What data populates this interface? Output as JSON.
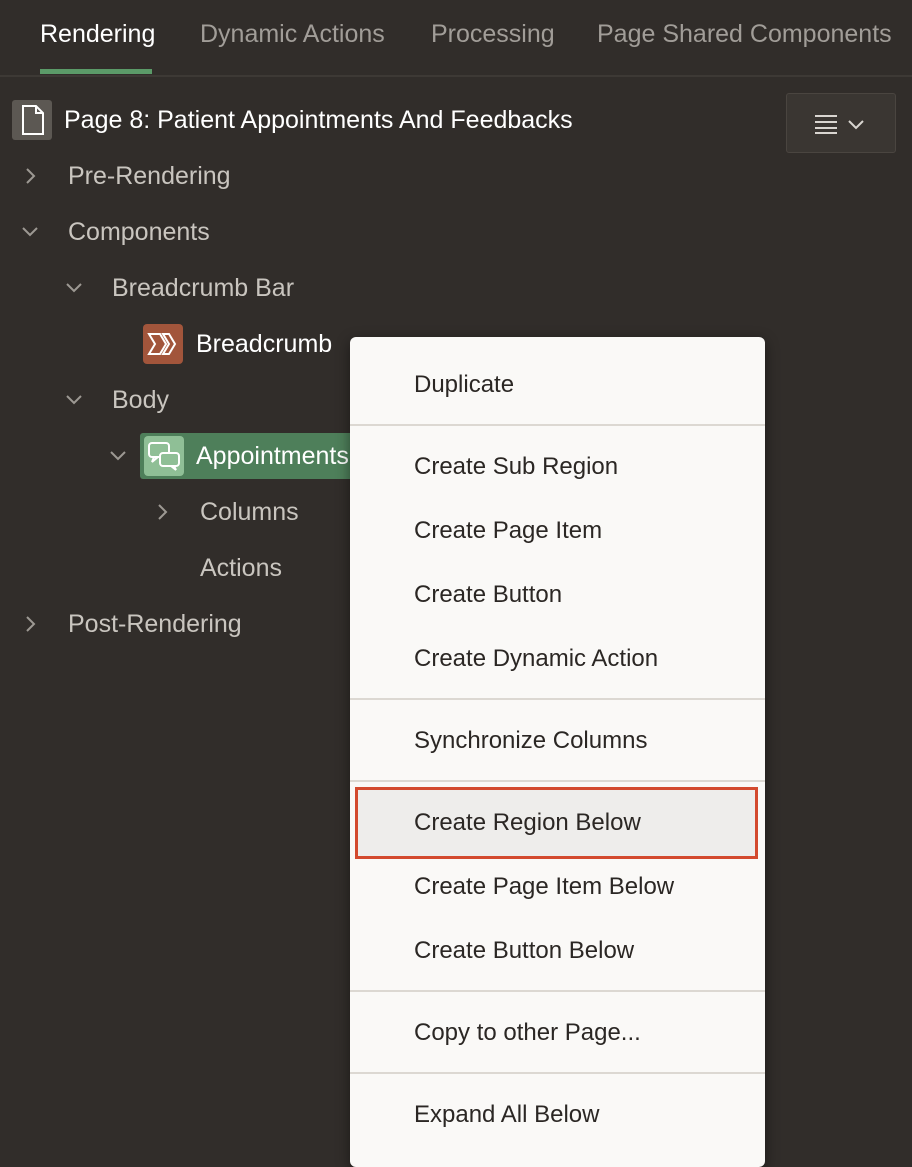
{
  "tabs": [
    {
      "label": "Rendering",
      "active": true
    },
    {
      "label": "Dynamic Actions",
      "active": false
    },
    {
      "label": "Processing",
      "active": false
    },
    {
      "label": "Page Shared Components",
      "active": false
    }
  ],
  "tree": {
    "page_title": "Page 8: Patient Appointments And Feedbacks",
    "pre_rendering": "Pre-Rendering",
    "components": "Components",
    "breadcrumb_bar": "Breadcrumb Bar",
    "breadcrumb": "Breadcrumb",
    "body": "Body",
    "appointments": "Appointments",
    "columns": "Columns",
    "actions": "Actions",
    "post_rendering": "Post-Rendering"
  },
  "context_menu": {
    "items": [
      "Duplicate",
      "Create Sub Region",
      "Create Page Item",
      "Create Button",
      "Create Dynamic Action",
      "Synchronize Columns",
      "Create Region Below",
      "Create Page Item Below",
      "Create Button Below",
      "Copy to other Page...",
      "Expand All Below"
    ],
    "highlighted": "Create Region Below"
  },
  "colors": {
    "background": "#312d2a",
    "active_tab_underline": "#5b9a68",
    "selected_node": "#4e7f5a",
    "breadcrumb_icon": "#a2553b",
    "highlight_border": "#d34a2e"
  },
  "icons": [
    "page-icon",
    "hamburger-menu-icon",
    "chevron-down-icon",
    "chevron-right-icon",
    "breadcrumb-icon",
    "chat-bubbles-icon"
  ]
}
